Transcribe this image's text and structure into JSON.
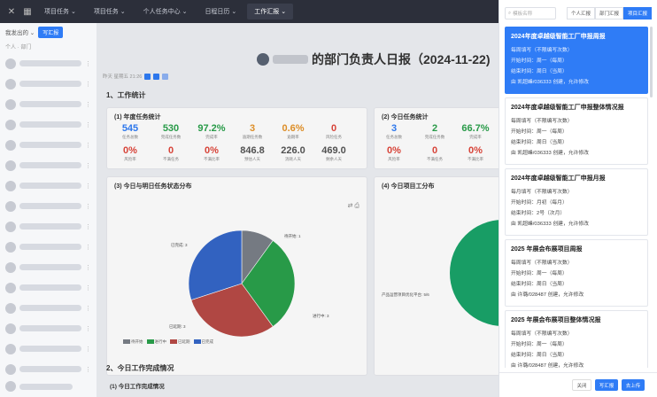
{
  "topbar": {
    "tabs": [
      "项目任务 ⌄",
      "项目任务 ⌄",
      "个人任务中心 ⌄",
      "日程日历 ⌄",
      "工作汇报 ⌄"
    ],
    "active_index": 4
  },
  "sidebar": {
    "header": "我发出的 ⌄",
    "header_btn": "写汇报",
    "subheader": "个人 · 部门"
  },
  "main": {
    "report_title": "的部门负责人日报（2024-11-22)",
    "meta": "昨天 星期五 21:26",
    "section1": "1、工作统计",
    "card_year_title": "(1) 年度任务统计",
    "card_today_title": "(2) 今日任务统计",
    "year_stats": [
      {
        "v": "545",
        "l": "任务总数",
        "c": "blue"
      },
      {
        "v": "530",
        "l": "完成任务数",
        "c": "green"
      },
      {
        "v": "97.2%",
        "l": "完成率",
        "c": "green"
      },
      {
        "v": "3",
        "l": "逾期任务数",
        "c": "orange"
      },
      {
        "v": "0.6%",
        "l": "逾期率",
        "c": "orange"
      },
      {
        "v": "0",
        "l": "风险任务",
        "c": "red"
      }
    ],
    "year_stats2": [
      {
        "v": "0%",
        "l": "风险率",
        "c": "red"
      },
      {
        "v": "0",
        "l": "不满任务",
        "c": "red"
      },
      {
        "v": "0%",
        "l": "不满比率",
        "c": "red"
      },
      {
        "v": "846.8",
        "l": "预估人天",
        "c": "gray"
      },
      {
        "v": "226.0",
        "l": "消耗人天",
        "c": "gray"
      },
      {
        "v": "469.0",
        "l": "剩余人天",
        "c": "gray"
      }
    ],
    "today_stats": [
      {
        "v": "3",
        "l": "任务总数",
        "c": "blue"
      },
      {
        "v": "2",
        "l": "完成任务数",
        "c": "green"
      },
      {
        "v": "66.7%",
        "l": "完成率",
        "c": "green"
      }
    ],
    "today_stats2": [
      {
        "v": "0%",
        "l": "风险率",
        "c": "red"
      },
      {
        "v": "0",
        "l": "不满任务",
        "c": "red"
      },
      {
        "v": "0%",
        "l": "不满比率",
        "c": "red"
      }
    ],
    "card_status_title": "(3) 今日与明日任务状态分布",
    "card_project_title": "(4) 今日项目工分布",
    "section2": "2、今日工作完成情况",
    "section2_sub": "(1) 今日工作完成情况",
    "project_label": "产品运营项目优化平台: 5/6"
  },
  "chart_data": {
    "type": "pie",
    "title": "(3) 今日与明日任务状态分布",
    "series": [
      {
        "name": "待开始",
        "value": 1,
        "color": "#7a7f88"
      },
      {
        "name": "进行中",
        "value": 3,
        "color": "#2aa14b"
      },
      {
        "name": "已延期",
        "value": 3,
        "color": "#b84a46"
      },
      {
        "name": "已完成",
        "value": 3,
        "color": "#3566c8"
      }
    ],
    "labels": [
      "待开始: 1",
      "进行中: 3",
      "已延期: 3",
      "已完成: 3"
    ]
  },
  "panel": {
    "search_placeholder": "模板名称",
    "tabs": [
      "个人汇报",
      "部门汇报",
      "项目汇报"
    ],
    "active_tab": 2,
    "items": [
      {
        "title": "2024年度卓越级智能工厂申报周报",
        "rows": [
          "每周填写（不限编写次数）",
          "开始时间：周一（每周）",
          "结束时间：周日（当周）",
          "由 凯超峰/036333 创建，允许修改"
        ]
      },
      {
        "title": "2024年度卓越级智能工厂申报整体情况报",
        "rows": [
          "每周填写（不限编写次数）",
          "开始时间：周一（每周）",
          "结束时间：周日（当周）",
          "由 凯超峰/036333 创建，允许修改"
        ]
      },
      {
        "title": "2024年度卓越级智能工厂申报月报",
        "rows": [
          "每月填写（不限编写次数）",
          "开始时间：月初（每月）",
          "结束时间：2号（次月）",
          "由 凯超峰/036333 创建，允许修改"
        ]
      },
      {
        "title": "2025 年展会布展项目周报",
        "rows": [
          "每周填写（不限编写次数）",
          "开始时间：周一（每周）",
          "结束时间：周日（当周）",
          "由 许璐/028487 创建，允许修改"
        ]
      },
      {
        "title": "2025 年展会布展项目整体情况报",
        "rows": [
          "每周填写（不限编写次数）",
          "开始时间：周一（每周）",
          "结束时间：周日（当周）",
          "由 许璐/028487 创建，允许修改"
        ]
      }
    ],
    "footer": {
      "cancel": "关闭",
      "write": "写汇报",
      "upload": "去上传"
    }
  }
}
